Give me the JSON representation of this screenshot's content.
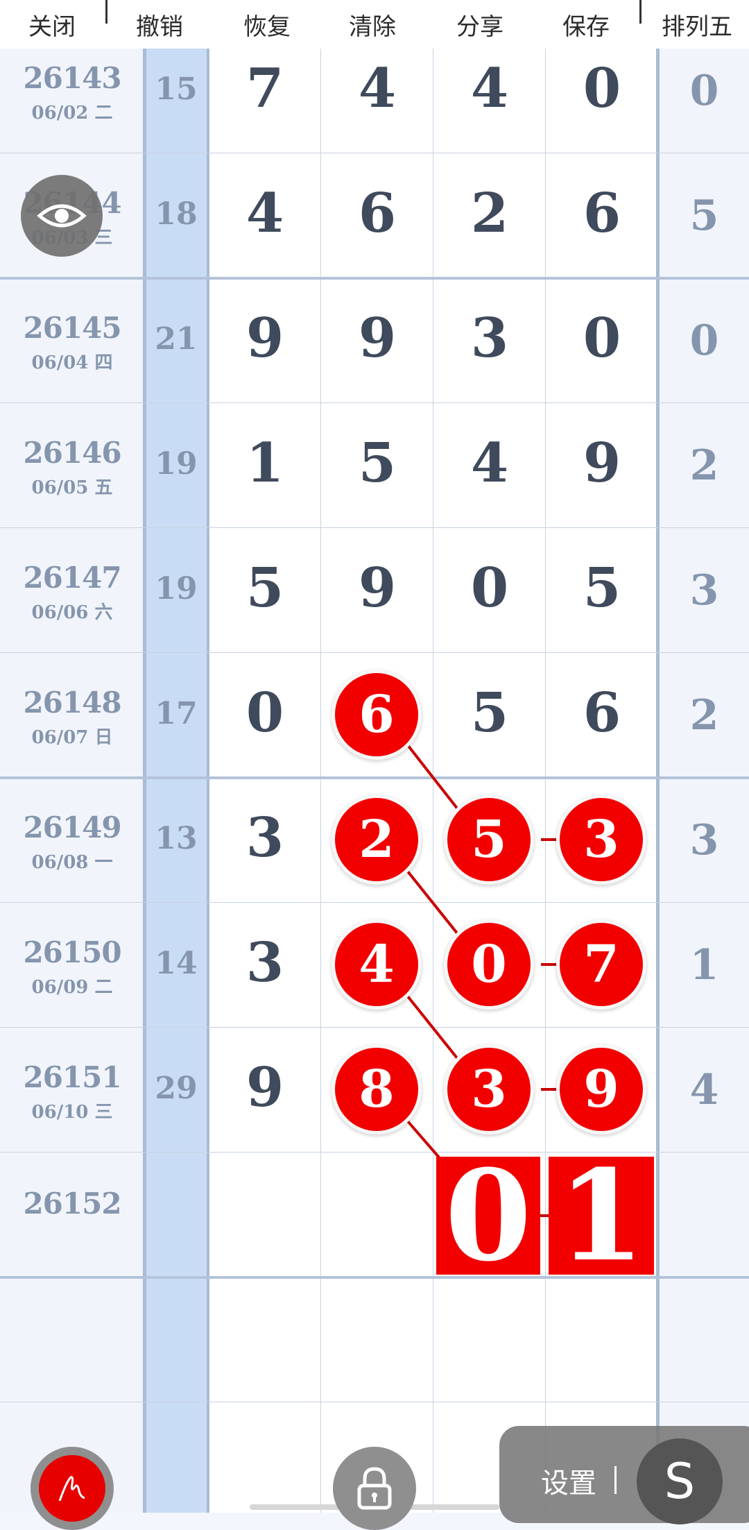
{
  "toolbar": {
    "close": "关闭",
    "undo": "撤销",
    "redo": "恢复",
    "clear": "清除",
    "share": "分享",
    "save": "保存",
    "p5": "排列五"
  },
  "rows": [
    {
      "id": "26143",
      "date": "06/02 二",
      "sum": "15",
      "d": [
        "7",
        "4",
        "4",
        "0"
      ],
      "r": "0"
    },
    {
      "id": "26144",
      "date": "06/03 三",
      "sum": "18",
      "d": [
        "4",
        "6",
        "2",
        "6"
      ],
      "r": "5"
    },
    {
      "id": "26145",
      "date": "06/04 四",
      "sum": "21",
      "d": [
        "9",
        "9",
        "3",
        "0"
      ],
      "r": "0"
    },
    {
      "id": "26146",
      "date": "06/05 五",
      "sum": "19",
      "d": [
        "1",
        "5",
        "4",
        "9"
      ],
      "r": "2"
    },
    {
      "id": "26147",
      "date": "06/06 六",
      "sum": "19",
      "d": [
        "5",
        "9",
        "0",
        "5"
      ],
      "r": "3"
    },
    {
      "id": "26148",
      "date": "06/07 日",
      "sum": "17",
      "d": [
        "0",
        "6",
        "5",
        "6"
      ],
      "r": "2"
    },
    {
      "id": "26149",
      "date": "06/08 一",
      "sum": "13",
      "d": [
        "3",
        "2",
        "5",
        "3"
      ],
      "r": "3"
    },
    {
      "id": "26150",
      "date": "06/09 二",
      "sum": "14",
      "d": [
        "3",
        "4",
        "0",
        "7"
      ],
      "r": "1"
    },
    {
      "id": "26151",
      "date": "06/10 三",
      "sum": "29",
      "d": [
        "9",
        "8",
        "3",
        "9"
      ],
      "r": "4"
    },
    {
      "id": "26152",
      "date": "",
      "sum": "",
      "d": [
        "",
        "",
        "",
        ""
      ],
      "r": ""
    }
  ],
  "prediction": [
    "0",
    "1"
  ],
  "settings": {
    "label": "设置",
    "icon_letter": "S"
  },
  "icons": {
    "eye": "eye-icon",
    "pen": "pen-icon",
    "lock": "lock-icon"
  },
  "colors": {
    "highlight": "#f20000",
    "sum_column": "#c9dcf5"
  }
}
